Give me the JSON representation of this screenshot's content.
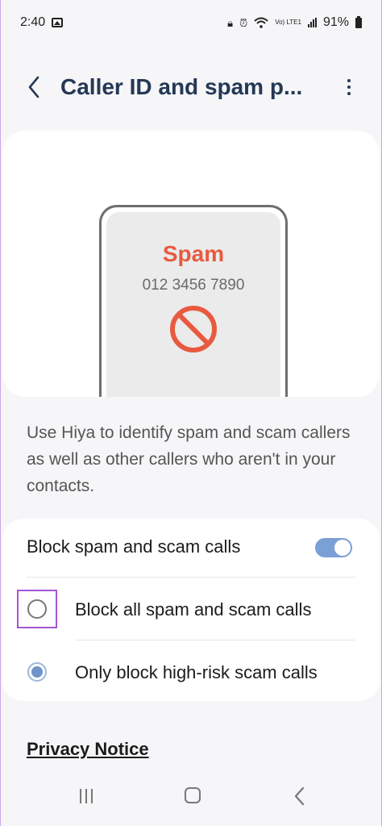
{
  "status_bar": {
    "time": "2:40",
    "network_label": "Vo) LTE1",
    "battery": "91%"
  },
  "header": {
    "title": "Caller ID and spam p..."
  },
  "illustration": {
    "spam_label": "Spam",
    "phone_number": "012 3456 7890"
  },
  "description": "Use Hiya to identify spam and scam callers as well as other callers who aren't in your contacts.",
  "settings": {
    "master_label": "Block spam and scam calls",
    "master_enabled": true,
    "options": [
      {
        "label": "Block all spam and scam calls",
        "selected": false
      },
      {
        "label": "Only block high-risk scam calls",
        "selected": true
      }
    ]
  },
  "privacy_link": "Privacy Notice",
  "colors": {
    "accent": "#7aa0d6",
    "title": "#253856",
    "spam_red": "#e85a3f",
    "highlight": "#a455d6"
  }
}
